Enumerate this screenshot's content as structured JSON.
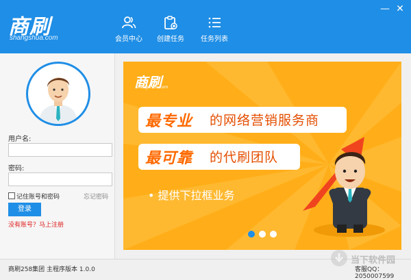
{
  "app": {
    "logo": "商刷",
    "logo_sub": "shangshua.com"
  },
  "nav": [
    {
      "label": "会员中心",
      "icon": "users-icon"
    },
    {
      "label": "创建任务",
      "icon": "clipboard-add-icon"
    },
    {
      "label": "任务列表",
      "icon": "list-icon"
    }
  ],
  "window": {
    "minimize": "—",
    "close": "✕"
  },
  "login": {
    "username_label": "用户名:",
    "username_value": "",
    "password_label": "密码:",
    "password_value": "",
    "remember_label": "记住账号和密码",
    "remember_checked": false,
    "forgot_label": "忘记密码",
    "login_button": "登录",
    "register_link": "没有账号？马上注册"
  },
  "banner": {
    "logo": "商刷",
    "logo_sub": "shangshua.com",
    "line1_highlight": "最专业",
    "line1_rest": "的网络营销服务商",
    "line2_highlight": "最可靠",
    "line2_rest": "的代刷团队",
    "bullet": "• 提供下拉框业务",
    "slides_total": 3,
    "active_slide": 1
  },
  "footer": {
    "version": "商刷258集团 主程序版本 1.0.0",
    "service": "客服QQ：2050007599"
  },
  "watermark": {
    "text": "当下软件园"
  },
  "colors": {
    "brand_blue": "#1f8ee6",
    "banner_orange": "#ffae19",
    "slogan_orange": "#ff6a00",
    "link_red": "#e02020"
  }
}
